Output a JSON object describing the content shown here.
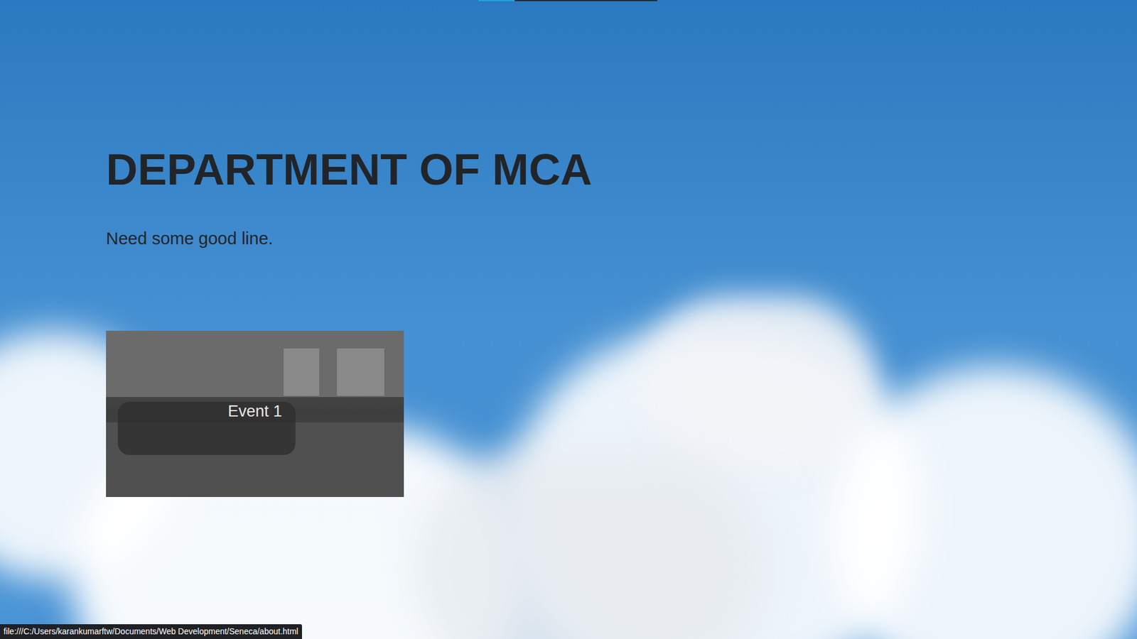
{
  "hero": {
    "title": "DEPARTMENT OF MCA",
    "subtitle": "Need some good line."
  },
  "carousel": {
    "slides": [
      {
        "caption": "Event 1",
        "selected": true
      }
    ]
  },
  "status_bar": {
    "url": "file:///C:/Users/karankumarftw/Documents/Web Development/Seneca/about.html"
  }
}
